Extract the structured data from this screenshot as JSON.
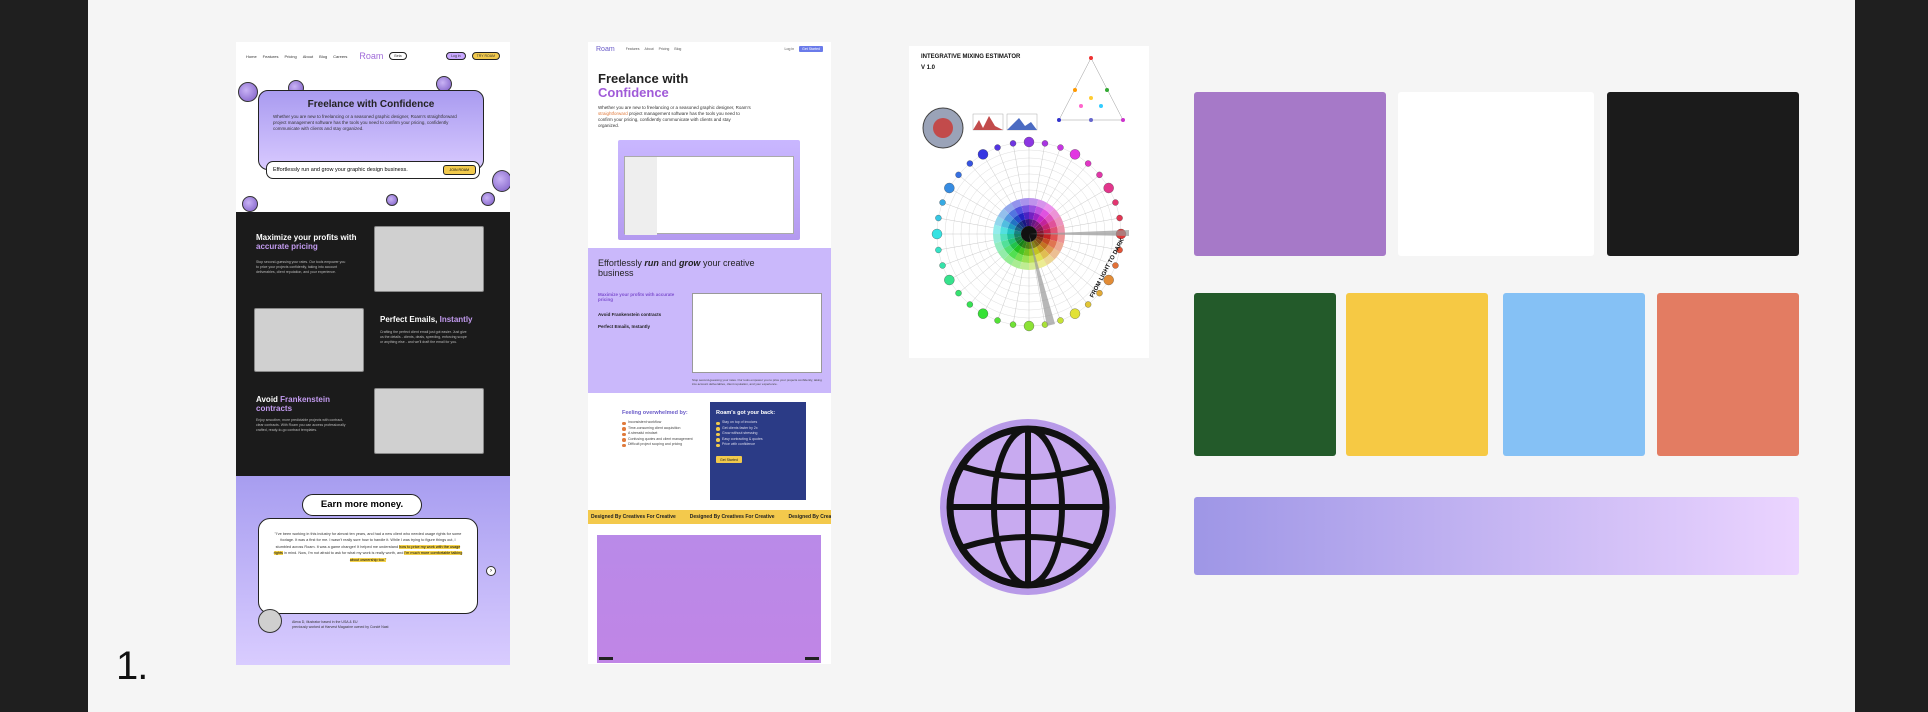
{
  "step_number": "1.",
  "mockup1": {
    "nav_links": [
      "Home",
      "Features",
      "Pricing",
      "About",
      "Blog",
      "Careers"
    ],
    "logo": "Roam",
    "beta": "Beta",
    "login": "Log in",
    "try_free": "TRY ROAM",
    "hero_title": "Freelance with Confidence",
    "hero_text": "Whether you are new to freelancing or a seasoned graphic designer, Roam's straightforward project management software has the tools you need to confirm your pricing, confidently communicate with clients and stay organized.",
    "cta_text": "Effortlessly run and grow your graphic design business.",
    "cta_button": "JOIN ROAM",
    "feature1_title_a": "Maximize your profits with",
    "feature1_title_b": "accurate pricing",
    "feature1_desc": "Stop second-guessing your rates. Our tools empower you to price your projects confidently, taking into account deliverables, client reputation, and your experience.",
    "feature2_title_a": "Perfect Emails,",
    "feature2_title_b": "Instantly",
    "feature2_desc": "Crafting the perfect client email just got easier. Just give us the details - clients, deals, speeding, enforcing scope or anything else - and we'll draft the email for you.",
    "feature3_title_a": "Avoid",
    "feature3_title_b": "Frankenstein contracts",
    "feature3_desc": "Enjoy smoother, more predictable projects with contract-clear contracts. With Roam you can access professionally crafted, ready-to-go contract templates.",
    "earn_title": "Earn more money.",
    "testimonial_a": "\"I've been working in this industry for almost ten years, and had a new client who needed usage rights for some footage. It was a first for me. I wasn't really sure how to handle it. While I was trying to figure things out, I stumbled across Roam. It was a game changer! It helped me understand",
    "testimonial_hl1": "how to price my work with the usage rights",
    "testimonial_b": "in mind. Now, I'm not afraid to ask for what my work is really worth, and",
    "testimonial_hl2": "I'm much more comfortable talking about ownership too.\"",
    "credit_line1": "Alexa D, illustrator based in the USA & EU",
    "credit_line2": "previously worked at Harvest Magazine owned by Condé Nast"
  },
  "mockup2": {
    "logo": "Roam",
    "nav_links": [
      "Features",
      "About",
      "Pricing",
      "Blog"
    ],
    "login": "Log in",
    "cta": "Get Started",
    "title_a": "Freelance with",
    "title_b": "Confidence",
    "intro_a": "Whether you are new to freelancing or a seasoned graphic designer, Roam's",
    "intro_hl": "straightforward",
    "intro_b": "project management software has the tools you need to confirm your pricing, confidently communicate with clients and stay organized.",
    "section_a": "Effortlessly",
    "section_run": "run",
    "section_and": "and",
    "section_grow": "grow",
    "section_b": "your creative business",
    "list1": "Maximize your profits with accurate pricing",
    "list2": "Avoid Frankenstein contracts",
    "list3": "Perfect Emails, Instantly",
    "caption": "Stop second-guessing your rates. Our tools empower you to price your projects confidently, taking into account deliverables, client reputation, and your experience.",
    "overwhelmed_title": "Feeling overwhelmed by:",
    "overwhelmed_items": [
      "Inconsistent workflow",
      "Time-consuming client acquisition",
      "A stressful mindset",
      "Confusing quotes and client management",
      "Difficult project scoping and pricing"
    ],
    "back_title": "Roam's got your back:",
    "back_items": [
      "Stay on top of invoices",
      "Get clients faster by 2x",
      "Grow without stressing",
      "Easy contracting & quotes",
      "Price with confidence"
    ],
    "back_button": "Get Started",
    "ticker": "Designed By Creatives For Creative"
  },
  "infographic": {
    "title": "INTEGRATIVE MIXING ESTIMATOR",
    "version": "V 1.0",
    "side_label": "FROM LIGHT TO DARK"
  },
  "colors": {
    "frame_bg": "#f5f5f5",
    "side_bars": "#1f1f1f",
    "accent_purple": "#a06bd8",
    "accent_yellow": "#f1c94c",
    "navy": "#2b3b86"
  },
  "palette": {
    "row1": [
      "#a679c8",
      "#ffffff",
      "#1b1b1b"
    ],
    "row2": [
      "#235a2a",
      "#f6c944",
      "#85c1f5",
      "#e37c62"
    ],
    "gradient": [
      "#9e96e6",
      "#ebd4ff"
    ]
  },
  "globe": {
    "ring": "#b89ae8",
    "fill": "#c8aaf0",
    "stroke": "#111111"
  }
}
